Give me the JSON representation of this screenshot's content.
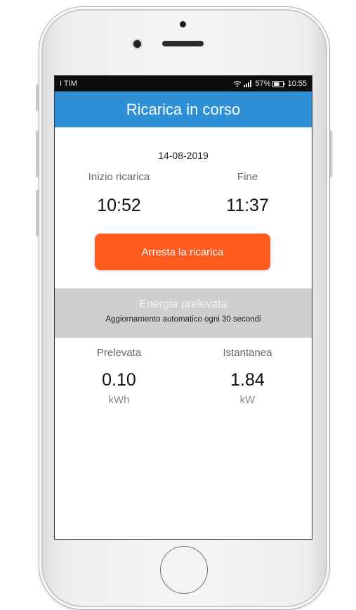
{
  "status_bar": {
    "carrier": "I TIM",
    "battery": "57%",
    "time": "10:55"
  },
  "header": {
    "title": "Ricarica in corso"
  },
  "session": {
    "date": "14-08-2019",
    "start_label": "Inizio ricarica",
    "end_label": "Fine",
    "start_time": "10:52",
    "end_time": "11:37"
  },
  "actions": {
    "stop_label": "Arresta la ricarica"
  },
  "energy": {
    "title": "Energia prelevata",
    "subtitle": "Aggiornamento automatico ogni 30 secondi",
    "drawn_label": "Prelevata",
    "instant_label": "Istantanea",
    "drawn_value": "0.10",
    "instant_value": "1.84",
    "drawn_unit": "kWh",
    "instant_unit": "kW"
  },
  "colors": {
    "header_blue": "#2d8fd6",
    "stop_orange": "#ff5a1f",
    "band_gray": "#cfcfcf"
  }
}
